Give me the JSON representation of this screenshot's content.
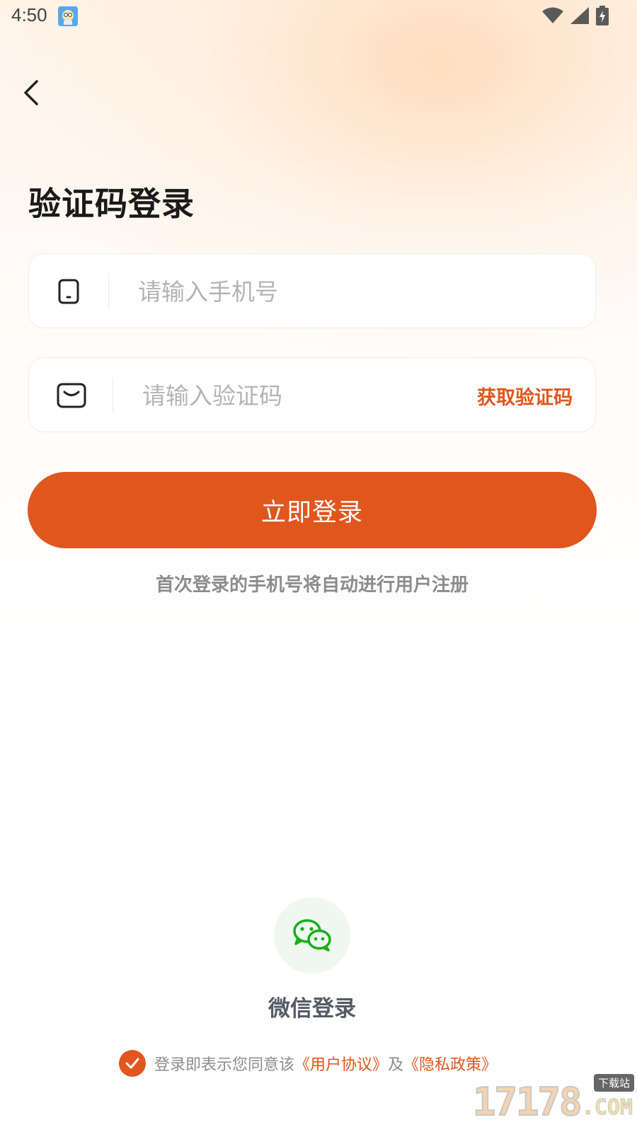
{
  "status_bar": {
    "time": "4:50",
    "icons": [
      "app-notification-icon",
      "wifi-icon",
      "cellular-signal-icon",
      "battery-charging-icon"
    ]
  },
  "nav": {
    "back_icon": "chevron-left-icon"
  },
  "title": "验证码登录",
  "phone_field": {
    "icon": "phone-icon",
    "value": "",
    "placeholder": "请输入手机号"
  },
  "code_field": {
    "icon": "message-icon",
    "value": "",
    "placeholder": "请输入验证码",
    "get_code_label": "获取验证码"
  },
  "login_button_label": "立即登录",
  "register_hint": "首次登录的手机号将自动进行用户注册",
  "wechat_login": {
    "icon": "wechat-icon",
    "label": "微信登录"
  },
  "agreement": {
    "checked": true,
    "prefix": "登录即表示您同意该",
    "user_agreement": "《用户协议》",
    "conjunction": "及",
    "privacy_policy": "《隐私政策》"
  },
  "watermark": {
    "digits": "17178",
    "badge": "下载站",
    "suffix": ".COM"
  },
  "colors": {
    "accent": "#e0561d",
    "wechat_green": "#1aad19",
    "wechat_bg": "#eef8f0"
  }
}
